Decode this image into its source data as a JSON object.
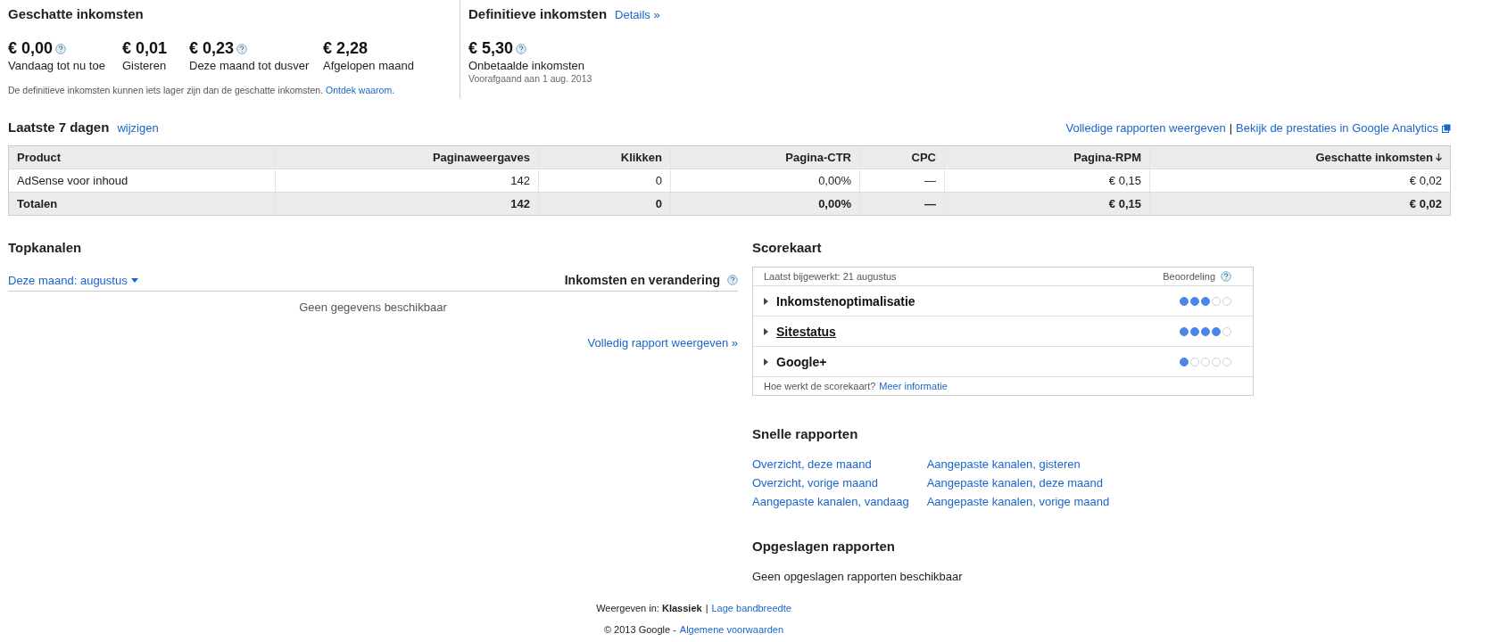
{
  "estimated": {
    "title": "Geschatte inkomsten",
    "metrics": [
      {
        "value": "€ 0,00",
        "label": "Vandaag tot nu toe",
        "help": true
      },
      {
        "value": "€ 0,01",
        "label": "Gisteren",
        "help": false
      },
      {
        "value": "€ 0,23",
        "label": "Deze maand tot dusver",
        "help": true
      },
      {
        "value": "€ 2,28",
        "label": "Afgelopen maand",
        "help": false
      }
    ],
    "note": "De definitieve inkomsten kunnen iets lager zijn dan de geschatte inkomsten.",
    "note_link": "Ontdek waarom."
  },
  "final": {
    "title": "Definitieve inkomsten",
    "link": "Details »",
    "value": "€ 5,30",
    "help": true,
    "label": "Onbetaalde inkomsten",
    "sublabel": "Voorafgaand aan 1 aug. 2013"
  },
  "period": {
    "title": "Laatste 7 dagen",
    "link": "wijzigen",
    "right_links": [
      "Volledige rapporten weergeven",
      "Bekijk de prestaties in Google Analytics"
    ],
    "separator": "|"
  },
  "table": {
    "columns": [
      {
        "label": "Product",
        "sorted": false
      },
      {
        "label": "Paginaweergaves",
        "sorted": false
      },
      {
        "label": "Klikken",
        "sorted": false
      },
      {
        "label": "Pagina-CTR",
        "sorted": false
      },
      {
        "label": "CPC",
        "sorted": false
      },
      {
        "label": "Pagina-RPM",
        "sorted": false
      },
      {
        "label": "Geschatte inkomsten",
        "sorted": true
      }
    ],
    "rows": [
      {
        "kind": "data",
        "cells": [
          "AdSense voor inhoud",
          "142",
          "0",
          "0,00%",
          "—",
          "€ 0,15",
          "€ 0,02"
        ]
      },
      {
        "kind": "total",
        "cells": [
          "Totalen",
          "142",
          "0",
          "0,00%",
          "—",
          "€ 0,15",
          "€ 0,02"
        ]
      }
    ]
  },
  "top_channels": {
    "title": "Topkanalen",
    "filter": "Deze maand: augustus",
    "column": "Inkomsten en verandering",
    "empty": "Geen gegevens beschikbaar",
    "link": "Volledig rapport weergeven »"
  },
  "scorecard": {
    "title": "Scorekaart",
    "updated": "Laatst bijgewerkt: 21 augustus",
    "rating": "Beoordeling",
    "items": [
      {
        "label": "Inkomstenoptimalisatie",
        "stars": 3,
        "underlined": false
      },
      {
        "label": "Sitestatus",
        "stars": 4,
        "underlined": true
      },
      {
        "label": "Google+",
        "stars": 1,
        "underlined": false
      }
    ],
    "footer": "Hoe werkt de scorekaart?",
    "footer_link": "Meer informatie"
  },
  "quick_reports": {
    "title": "Snelle rapporten",
    "links": [
      "Overzicht, deze maand",
      "Overzicht, vorige maand",
      "Aangepaste kanalen, vandaag",
      "Aangepaste kanalen, gisteren",
      "Aangepaste kanalen, deze maand",
      "Aangepaste kanalen, vorige maand"
    ]
  },
  "saved_reports": {
    "title": "Opgeslagen rapporten",
    "empty": "Geen opgeslagen rapporten beschikbaar"
  },
  "footer": {
    "view": "Weergeven in: **Klassiek**",
    "separator": "|",
    "view_link": "Lage bandbreedte",
    "copyright": "© 2013 Google -",
    "terms_link": "Algemene voorwaarden"
  }
}
